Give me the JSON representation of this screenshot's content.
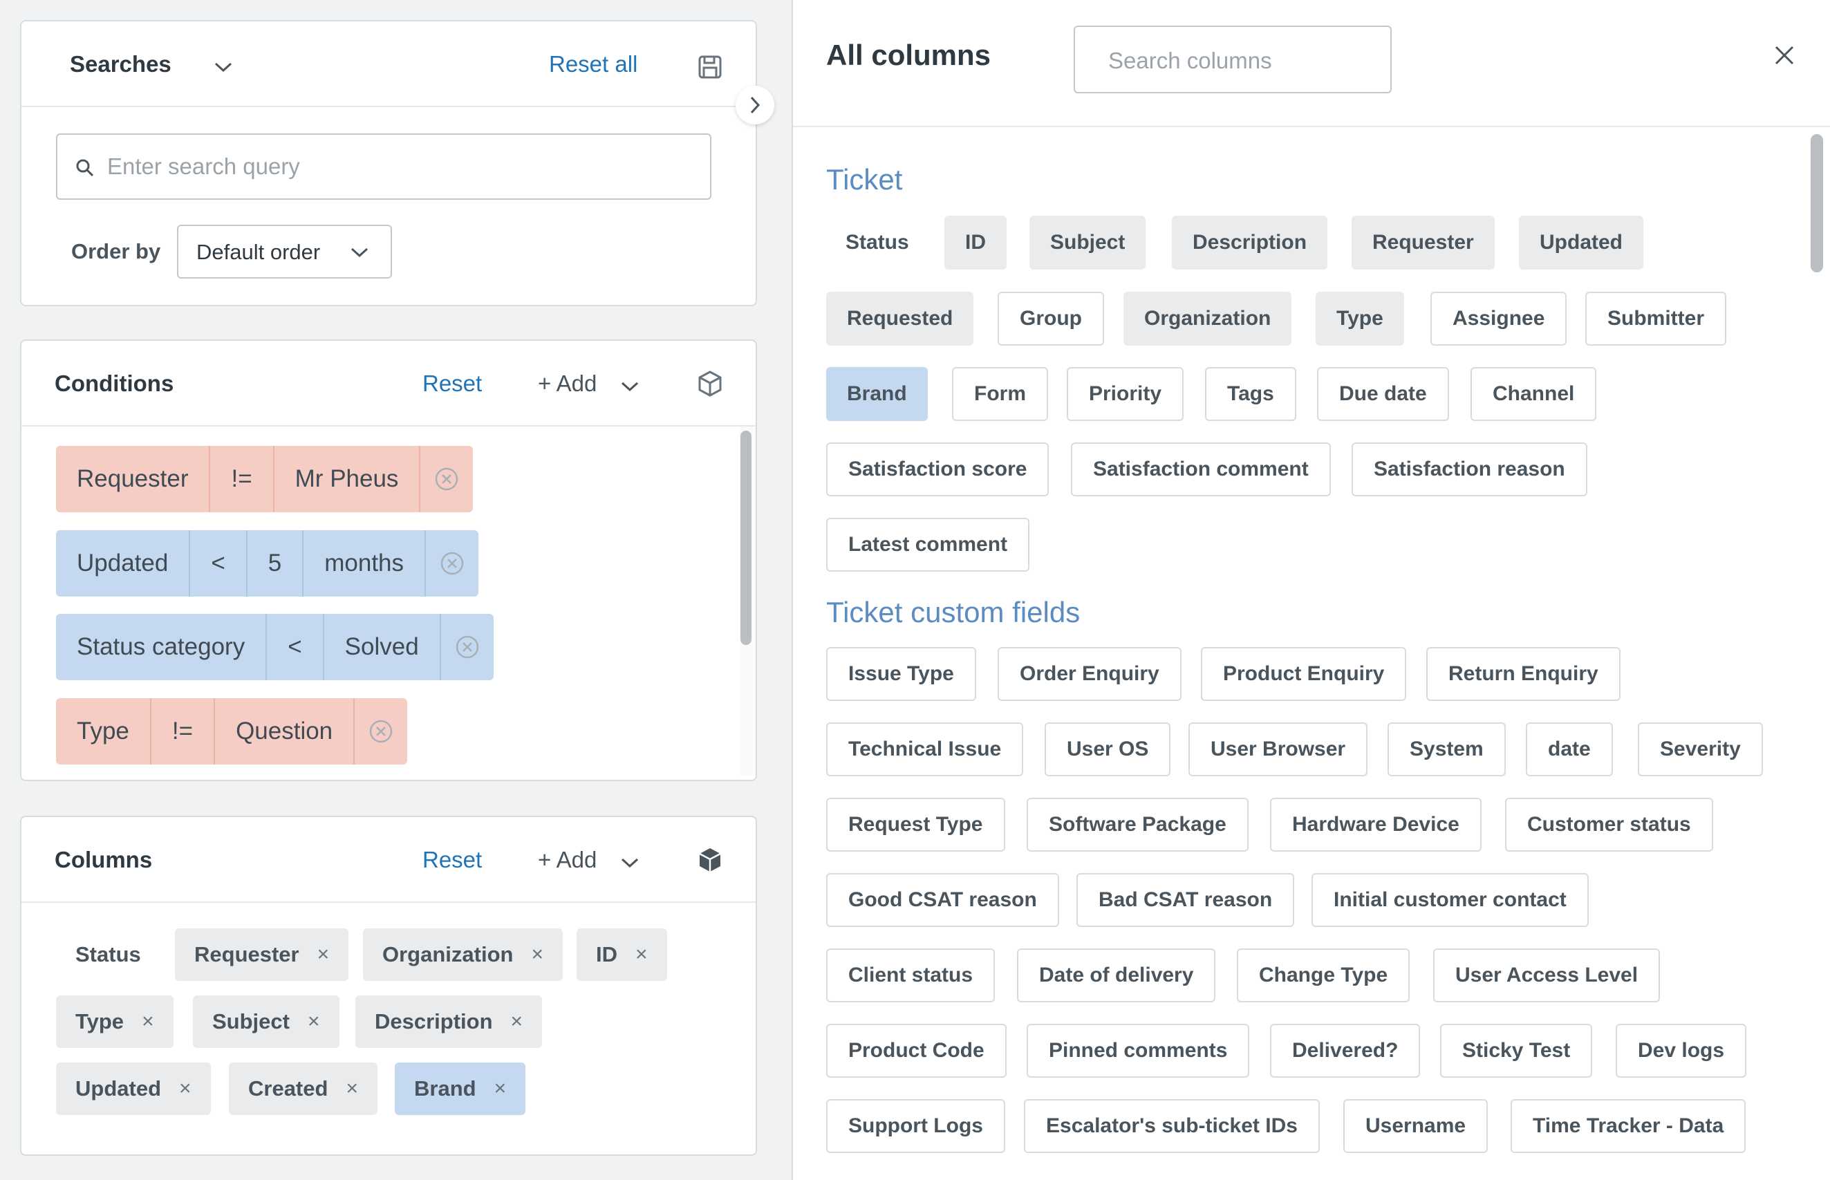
{
  "searches": {
    "title": "Searches",
    "reset_all": "Reset all",
    "search_placeholder": "Enter search query",
    "order_label": "Order by",
    "order_value": "Default order"
  },
  "conditions": {
    "title": "Conditions",
    "reset": "Reset",
    "add": "+ Add",
    "rows": [
      {
        "field": "Requester",
        "op": "!=",
        "value": "Mr Pheus",
        "color": "#f6cdc4"
      },
      {
        "field": "Updated",
        "op": "<",
        "num": "5",
        "value": "months",
        "color": "#c4d8ef"
      },
      {
        "field": "Status category",
        "op": "<",
        "value": "Solved",
        "color": "#c4d8ef"
      },
      {
        "field": "Type",
        "op": "!=",
        "value": "Question",
        "color": "#f6cdc4"
      }
    ]
  },
  "columns": {
    "title": "Columns",
    "reset": "Reset",
    "add": "+ Add",
    "tags": [
      "Status",
      "Requester",
      "Organization",
      "ID",
      "Type",
      "Subject",
      "Description",
      "Updated",
      "Created",
      "Brand"
    ],
    "remove_glyph": "×"
  },
  "all_columns": {
    "title": "All columns",
    "search_placeholder": "Search columns",
    "ticket_section": "Ticket",
    "ticket_chips": [
      "Status",
      "ID",
      "Subject",
      "Description",
      "Requester",
      "Updated",
      "Requested",
      "Group",
      "Organization",
      "Type",
      "Assignee",
      "Submitter",
      "Brand",
      "Form",
      "Priority",
      "Tags",
      "Due date",
      "Channel",
      "Satisfaction score",
      "Satisfaction comment",
      "Satisfaction reason",
      "Latest comment"
    ],
    "custom_section": "Ticket custom fields",
    "custom_chips": [
      "Issue Type",
      "Order Enquiry",
      "Product Enquiry",
      "Return Enquiry",
      "Technical Issue",
      "User OS",
      "User Browser",
      "System",
      "date",
      "Severity",
      "Request Type",
      "Software Package",
      "Hardware Device",
      "Customer status",
      "Good CSAT reason",
      "Bad CSAT reason",
      "Initial customer contact",
      "Client status",
      "Date of delivery",
      "Change Type",
      "User Access Level",
      "Product Code",
      "Pinned comments",
      "Delivered?",
      "Sticky Test",
      "Dev logs",
      "Support Logs",
      "Escalator's sub-ticket IDs",
      "Username",
      "Time Tracker - Data"
    ]
  },
  "colors": {
    "link": "#1f73b7",
    "section": "#5a8bc1",
    "condition_red": "#f6cdc4",
    "condition_blue": "#c4d8ef",
    "chip_selected": "#c4d8ef"
  },
  "icons": [
    "chevron-down-icon",
    "save-icon",
    "search-icon",
    "cube-outline-icon",
    "cube-filled-icon",
    "close-circle-icon",
    "close-icon",
    "chevron-right-icon"
  ]
}
